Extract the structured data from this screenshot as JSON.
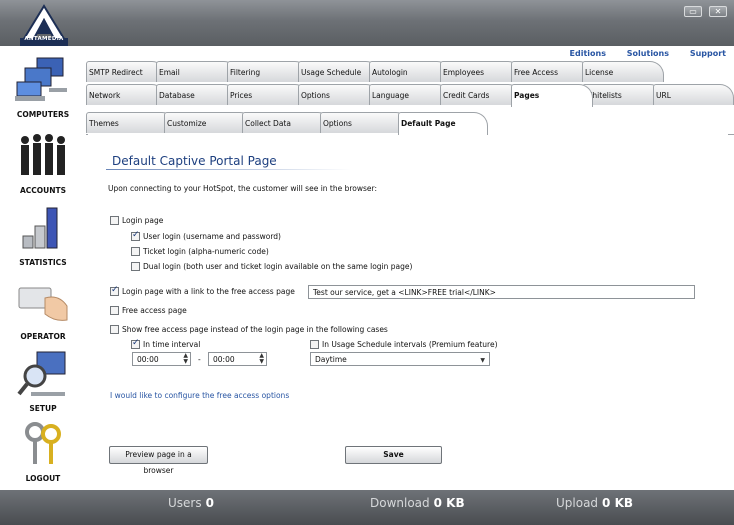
{
  "app": {
    "logo_text": "ANTAMEDIA"
  },
  "window_buttons": [
    {
      "label": "▭"
    },
    {
      "label": "✕"
    }
  ],
  "toplinks": [
    "Editions",
    "Solutions",
    "Support"
  ],
  "sidebar": [
    {
      "label": "COMPUTERS",
      "icon": "computers-icon"
    },
    {
      "label": "ACCOUNTS",
      "icon": "people-icon"
    },
    {
      "label": "STATISTICS",
      "icon": "bar-chart-icon"
    },
    {
      "label": "OPERATOR",
      "icon": "hand-card-icon"
    },
    {
      "label": "SETUP",
      "icon": "magnifier-monitor-icon"
    },
    {
      "label": "LOGOUT",
      "icon": "keys-icon"
    }
  ],
  "tabs_row1": [
    "SMTP Redirect",
    "Email",
    "Filtering",
    "Usage Schedule",
    "Autologin",
    "Employees",
    "Free Access",
    "License"
  ],
  "tabs_row2": [
    "Network",
    "Database",
    "Prices",
    "Options",
    "Language",
    "Credit Cards",
    "Pages",
    "Whitelists",
    "URL"
  ],
  "tabs_row3": [
    "Themes",
    "Customize",
    "Collect Data",
    "Options",
    "Default Page"
  ],
  "content": {
    "heading": "Default Captive Portal Page",
    "intro": "Upon connecting to your HotSpot, the customer will see in the browser:",
    "login_page": "Login page",
    "user_login": "User login (username and password)",
    "ticket_login": "Ticket login (alpha-numeric code)",
    "dual_login": "Dual login (both user and ticket login available on the same login page)",
    "login_link": "Login page with a link to the free access page",
    "login_link_value": "Test our service, get a <LINK>FREE trial</LINK>",
    "free_access": "Free access page",
    "show_free": "Show free access page instead of the login page in the following cases",
    "time_interval": "In time interval",
    "time_from": "00:00",
    "time_sep": "-",
    "time_to": "00:00",
    "usage_schedule": "In Usage Schedule intervals  (Premium feature)",
    "schedule_value": "Daytime",
    "configure_link": "I would like to configure the free access options",
    "preview_button": "Preview page in a browser",
    "save_button": "Save"
  },
  "status": {
    "users_label": "Users",
    "users_value": "0",
    "download_label": "Download",
    "download_value": "0 KB",
    "upload_label": "Upload",
    "upload_value": "0 KB"
  }
}
